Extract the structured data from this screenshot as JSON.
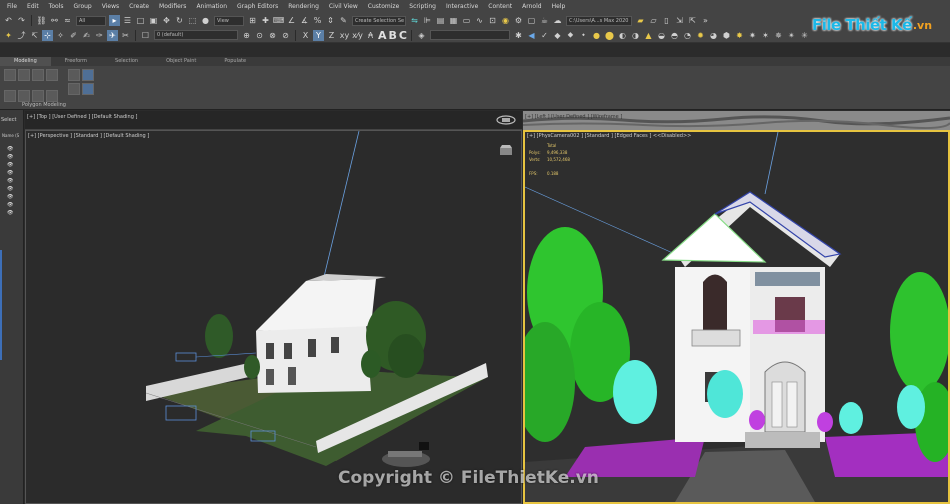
{
  "menu": [
    "File",
    "Edit",
    "Tools",
    "Group",
    "Views",
    "Create",
    "Modifiers",
    "Animation",
    "Graph Editors",
    "Rendering",
    "Civil View",
    "Customize",
    "Scripting",
    "Interactive",
    "Content",
    "Arnold",
    "Help"
  ],
  "toolbar": {
    "filter_value": "All",
    "view_value": "View",
    "selection_set": "Create Selection Se",
    "path_value": "C:\\Users\\A...s Max 2020",
    "layer_value": "0 (default)",
    "text_letters": [
      "A",
      "B",
      "C"
    ]
  },
  "ribbon": {
    "tabs": [
      "Modeling",
      "Freeform",
      "Selection",
      "Object Paint",
      "Populate"
    ],
    "panel_label": "Polygon Modeling"
  },
  "explorer": {
    "select_label": "Select",
    "name_header": "Name (S"
  },
  "viewports": {
    "top_label": "[+] [Top ] [User Defined ] [Default Shading ]",
    "top2_label": "[+] [Left ] [User Defined ] [Wireframe ]",
    "persp_label": "[+] [Perspective ] [Standard ] [Default Shading ]",
    "cam_label": "[+] [PhysCamera002 ] [Standard ] [Edged Faces ]  <<Disabled>>",
    "stats": {
      "total_label": "Total",
      "polys_label": "Polys:",
      "polys_value": "9,496,338",
      "verts_label": "Verts:",
      "verts_value": "10,572,468",
      "fps_label": "FPS:",
      "fps_value": "0.188"
    }
  },
  "watermark": {
    "logo_text": "File Thiết Kế",
    "logo_suffix": ".vn",
    "copyright": "Copyright © FileThietKe.vn"
  },
  "colors": {
    "accent": "#5b7fa6",
    "active_viewport_border": "#e7c440",
    "tree_green": "#2ec82e",
    "tree_cyan": "#5ff0e0",
    "ground_purple": "#b020d0"
  }
}
